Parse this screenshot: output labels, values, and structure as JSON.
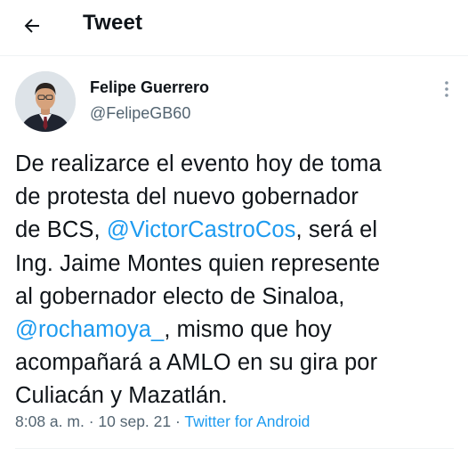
{
  "header": {
    "title": "Tweet",
    "back_icon": "arrow-left-icon"
  },
  "author": {
    "name": "Felipe Guerrero",
    "handle": "@FelipeGB60"
  },
  "tweet": {
    "lines": [
      {
        "parts": [
          {
            "text": "De realizarce el evento hoy de toma"
          }
        ]
      },
      {
        "parts": [
          {
            "text": "de protesta del nuevo gobernador"
          }
        ]
      },
      {
        "parts": [
          {
            "text": "de BCS, "
          },
          {
            "text": "@VictorCastroCos",
            "mention": true
          },
          {
            "text": ", será el"
          }
        ]
      },
      {
        "parts": [
          {
            "text": "Ing. Jaime Montes quien represente"
          }
        ]
      },
      {
        "parts": [
          {
            "text": "al gobernador electo de Sinaloa,"
          }
        ]
      },
      {
        "parts": [
          {
            "text": "@rochamoya_",
            "mention": true
          },
          {
            "text": ", mismo que hoy"
          }
        ]
      },
      {
        "parts": [
          {
            "text": "acompañará a AMLO en su gira por"
          }
        ]
      },
      {
        "parts": [
          {
            "text": "Culiacán y Mazatlán."
          }
        ]
      }
    ],
    "time": "8:08 a. m.",
    "separator": " · ",
    "date": "10 sep. 21",
    "source": "Twitter for Android"
  },
  "colors": {
    "text": "#0f1419",
    "secondary": "#536471",
    "accent": "#1d9bf0",
    "divider": "#eff3f4"
  },
  "icons": {
    "more": "more-vertical-icon"
  }
}
